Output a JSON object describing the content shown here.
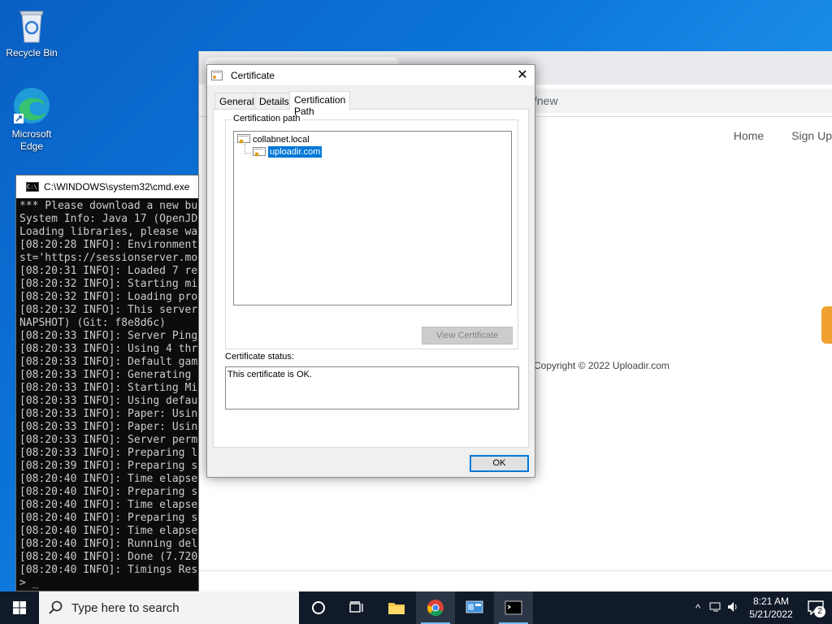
{
  "desktop": {
    "icons": [
      {
        "label": "Recycle Bin"
      },
      {
        "label": "Microsoft Edge"
      }
    ]
  },
  "browser": {
    "address_text": "s/new",
    "nav": [
      "Home",
      "Sign Up"
    ],
    "copyright": "Copyright © 2022 Uploadir.com"
  },
  "cmd": {
    "title": "C:\\WINDOWS\\system32\\cmd.exe",
    "lines": [
      "*** Please download a new bu",
      "System Info: Java 17 (OpenJD",
      "Loading libraries, please wa",
      "[08:20:28 INFO]: Environment",
      "st='https://sessionserver.mo",
      "[08:20:31 INFO]: Loaded 7 re",
      "[08:20:32 INFO]: Starting mi",
      "[08:20:32 INFO]: Loading pro",
      "[08:20:32 INFO]: This server",
      "NAPSHOT) (Git: f8e8d6c)",
      "[08:20:33 INFO]: Server Ping",
      "[08:20:33 INFO]: Using 4 thr",
      "[08:20:33 INFO]: Default gam",
      "[08:20:33 INFO]: Generating",
      "[08:20:33 INFO]: Starting Mi",
      "[08:20:33 INFO]: Using defau",
      "[08:20:33 INFO]: Paper: Usin",
      "[08:20:33 INFO]: Paper: Usin",
      "[08:20:33 INFO]: Server perm",
      "[08:20:33 INFO]: Preparing l",
      "[08:20:39 INFO]: Preparing s",
      "[08:20:40 INFO]: Time elapse",
      "[08:20:40 INFO]: Preparing s",
      "[08:20:40 INFO]: Time elapse",
      "[08:20:40 INFO]: Preparing s",
      "[08:20:40 INFO]: Time elapse",
      "[08:20:40 INFO]: Running del",
      "[08:20:40 INFO]: Done (7.720",
      "[08:20:40 INFO]: Timings Res",
      "> _"
    ]
  },
  "certificate": {
    "title": "Certificate",
    "tabs": [
      "General",
      "Details",
      "Certification Path"
    ],
    "path_group_label": "Certification path",
    "tree": [
      {
        "label": "collabnet.local"
      },
      {
        "label": "uploadir.com"
      }
    ],
    "view_button": "View Certificate",
    "status_label": "Certificate status:",
    "status_text": "This certificate is OK.",
    "ok_button": "OK"
  },
  "taskbar": {
    "search_placeholder": "Type here to search",
    "time": "8:21 AM",
    "date": "5/21/2022",
    "notification_count": "2"
  }
}
